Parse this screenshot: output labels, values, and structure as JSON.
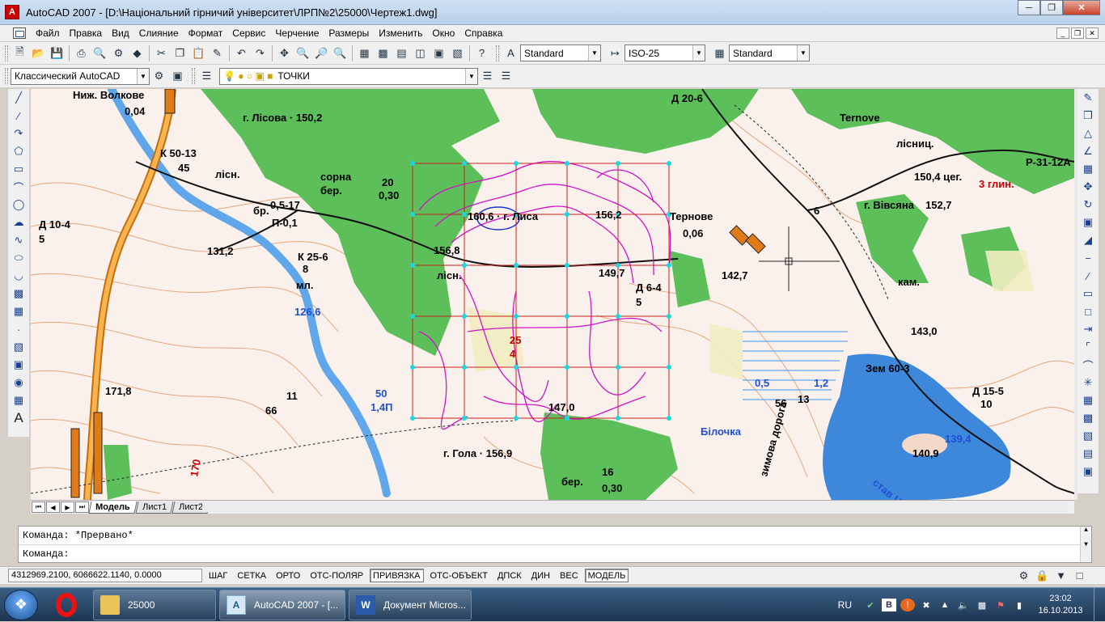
{
  "window": {
    "title": "AutoCAD 2007 - [D:\\Національний гірничий університет\\ЛРП№2\\25000\\Чертеж1.dwg]"
  },
  "menu": [
    "Файл",
    "Правка",
    "Вид",
    "Слияние",
    "Формат",
    "Сервис",
    "Черчение",
    "Размеры",
    "Изменить",
    "Окно",
    "Справка"
  ],
  "toolbar": {
    "text_style": "Standard",
    "dim_style": "ISO-25",
    "table_style": "Standard",
    "workspace": "Классический AutoCAD",
    "layer": "ТОЧКИ"
  },
  "map_labels": [
    {
      "text": "Ниж. Волкове",
      "color": "#000"
    },
    {
      "text": "0,04",
      "color": "#000"
    },
    {
      "text": "К 50-13",
      "color": "#000"
    },
    {
      "text": "45",
      "color": "#000"
    },
    {
      "text": "Д 10-4",
      "color": "#000"
    },
    {
      "text": "5",
      "color": "#000"
    },
    {
      "text": "131,2",
      "color": "#000"
    },
    {
      "text": "г. Лісова · 150,2",
      "color": "#000"
    },
    {
      "text": "лісн.",
      "color": "#000"
    },
    {
      "text": "сорна",
      "color": "#000"
    },
    {
      "text": "бер.",
      "color": "#000"
    },
    {
      "text": "20",
      "color": "#000"
    },
    {
      "text": "0,30",
      "color": "#000"
    },
    {
      "text": "бр.",
      "color": "#000"
    },
    {
      "text": "0,5-17",
      "color": "#000"
    },
    {
      "text": "П-0,1",
      "color": "#000"
    },
    {
      "text": "К 25-6",
      "color": "#000"
    },
    {
      "text": "8",
      "color": "#000"
    },
    {
      "text": "мл.",
      "color": "#000"
    },
    {
      "text": "126,6",
      "color": "#1f4fd6"
    },
    {
      "text": "160,6 · г. Лиса",
      "color": "#000"
    },
    {
      "text": "156,2",
      "color": "#000"
    },
    {
      "text": "156,8",
      "color": "#000"
    },
    {
      "text": "лісн.",
      "color": "#000"
    },
    {
      "text": "149,7",
      "color": "#000"
    },
    {
      "text": "Ternove",
      "color": "#000"
    },
    {
      "text": "Тернове",
      "color": "#000"
    },
    {
      "text": "0,06",
      "color": "#000"
    },
    {
      "text": "142,7",
      "color": "#000"
    },
    {
      "text": "Д 6-4",
      "color": "#000"
    },
    {
      "text": "5",
      "color": "#000"
    },
    {
      "text": "150,4 цег.",
      "color": "#000"
    },
    {
      "text": "лісниц.",
      "color": "#000"
    },
    {
      "text": "г. Вівсяна",
      "color": "#000"
    },
    {
      "text": "152,7",
      "color": "#000"
    },
    {
      "text": "3 глин.",
      "color": "#c00"
    },
    {
      "text": "кам.",
      "color": "#000"
    },
    {
      "text": "143,0",
      "color": "#000"
    },
    {
      "text": "Зем 60-3",
      "color": "#000"
    },
    {
      "text": "Д 15-5",
      "color": "#000"
    },
    {
      "text": "10",
      "color": "#000"
    },
    {
      "text": "Д 20-6",
      "color": "#000"
    },
    {
      "text": "171,8",
      "color": "#000"
    },
    {
      "text": "66",
      "color": "#000"
    },
    {
      "text": "11",
      "color": "#000"
    },
    {
      "text": "50",
      "color": "#1f4fd6"
    },
    {
      "text": "1,4П",
      "color": "#1f4fd6"
    },
    {
      "text": "147,0",
      "color": "#000"
    },
    {
      "text": "г. Гола · 156,9",
      "color": "#000"
    },
    {
      "text": "Білочка",
      "color": "#1f4fd6"
    },
    {
      "text": "бер.",
      "color": "#000"
    },
    {
      "text": "16",
      "color": "#000"
    },
    {
      "text": "0,30",
      "color": "#000"
    },
    {
      "text": "0,5",
      "color": "#1f4fd6"
    },
    {
      "text": "1,2",
      "color": "#1f4fd6"
    },
    {
      "text": "13",
      "color": "#000"
    },
    {
      "text": "56",
      "color": "#000"
    },
    {
      "text": "став Чорний",
      "color": "#1f4fd6"
    },
    {
      "text": "139,4",
      "color": "#1f4fd6"
    },
    {
      "text": "140,9",
      "color": "#000"
    },
    {
      "text": "зимова дорога",
      "color": "#000"
    },
    {
      "text": "Р-31-12А",
      "color": "#000"
    },
    {
      "text": "25",
      "color": "#c00"
    },
    {
      "text": "4",
      "color": "#c00"
    },
    {
      "text": "170",
      "color": "#c00"
    },
    {
      "text": "6",
      "color": "#000"
    }
  ],
  "layout_tabs": [
    "Модель",
    "Лист1",
    "Лист2"
  ],
  "command": {
    "history": "Команда: *Прервано*",
    "prompt": "Команда:"
  },
  "status": {
    "coords": "4312969.2100, 6066622.1140, 0.0000",
    "toggles": [
      {
        "label": "ШАГ",
        "on": false
      },
      {
        "label": "СЕТКА",
        "on": false
      },
      {
        "label": "ОРТО",
        "on": false
      },
      {
        "label": "ОТС-ПОЛЯР",
        "on": false
      },
      {
        "label": "ПРИВЯЗКА",
        "on": true
      },
      {
        "label": "ОТС-ОБЪЕКТ",
        "on": false
      },
      {
        "label": "ДПСК",
        "on": false
      },
      {
        "label": "ДИН",
        "on": false
      },
      {
        "label": "ВЕС",
        "on": false
      },
      {
        "label": "МОДЕЛЬ",
        "on": true
      }
    ]
  },
  "taskbar": {
    "tasks": [
      {
        "label": "25000",
        "icon": "folder-icon",
        "active": false
      },
      {
        "label": "AutoCAD 2007 - [...",
        "icon": "autocad-icon",
        "active": true
      },
      {
        "label": "Документ Micros...",
        "icon": "word-icon",
        "active": false
      }
    ],
    "lang": "RU",
    "time": "23:02",
    "date": "16.10.2013"
  }
}
